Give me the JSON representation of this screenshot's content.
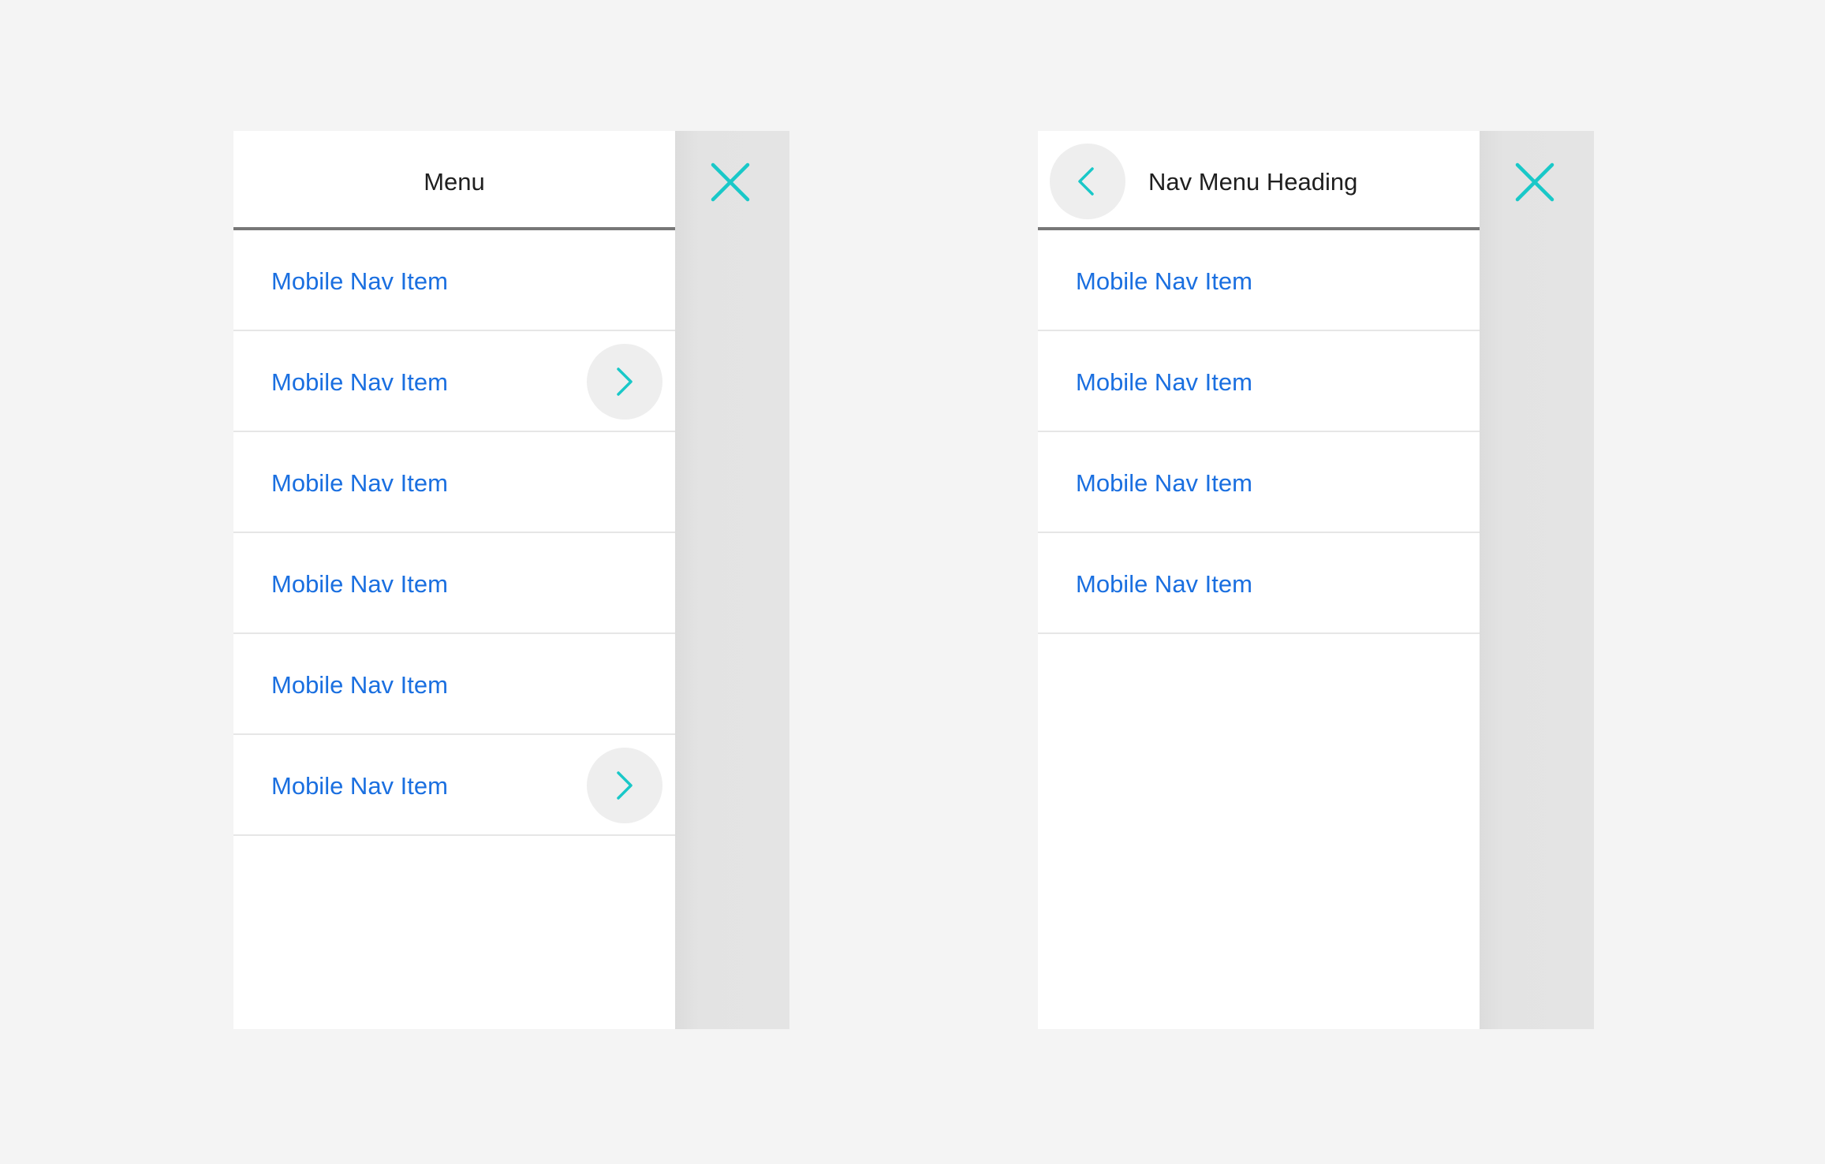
{
  "colors": {
    "background": "#f4f4f4",
    "panel": "#ffffff",
    "overlay": "#e4e4e4",
    "accent_teal": "#19c8c8",
    "link_blue": "#1a6fe0",
    "heading_text": "#1f1f1f",
    "header_rule": "#777777",
    "divider": "#e6e6e6",
    "icon_button_bg": "#eeeeee"
  },
  "left_menu": {
    "title": "Menu",
    "close_icon": "close-icon",
    "items": [
      {
        "label": "Mobile Nav Item",
        "has_submenu": false
      },
      {
        "label": "Mobile Nav Item",
        "has_submenu": true,
        "icon": "chevron-right-icon"
      },
      {
        "label": "Mobile Nav Item",
        "has_submenu": false
      },
      {
        "label": "Mobile Nav Item",
        "has_submenu": false
      },
      {
        "label": "Mobile Nav Item",
        "has_submenu": false
      },
      {
        "label": "Mobile Nav Item",
        "has_submenu": true,
        "icon": "chevron-right-icon"
      }
    ]
  },
  "right_menu": {
    "title": "Nav Menu Heading",
    "back_icon": "chevron-left-icon",
    "close_icon": "close-icon",
    "items": [
      {
        "label": "Mobile Nav Item"
      },
      {
        "label": "Mobile Nav Item"
      },
      {
        "label": "Mobile Nav Item"
      },
      {
        "label": "Mobile Nav Item"
      }
    ]
  }
}
